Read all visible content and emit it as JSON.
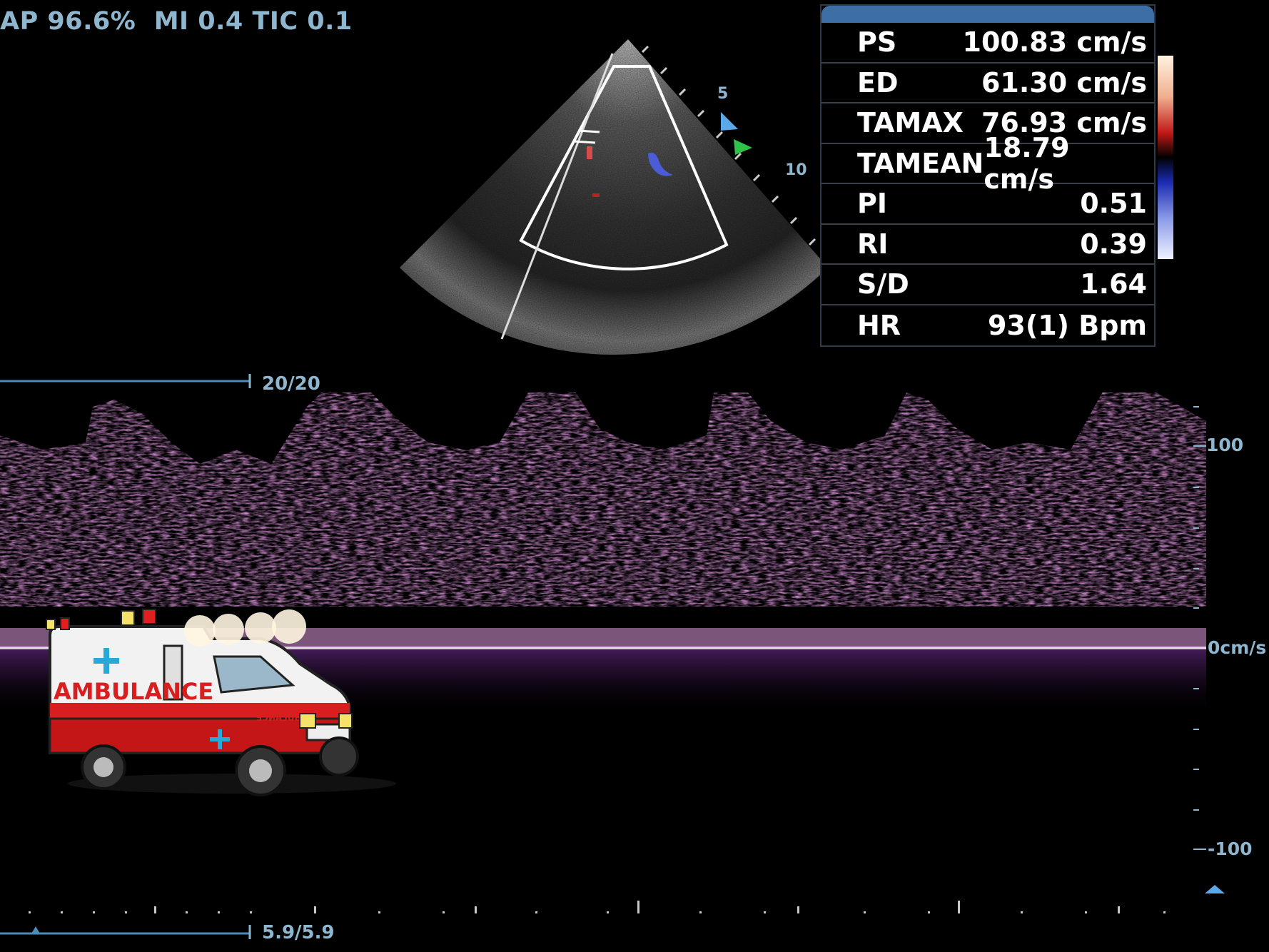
{
  "header": {
    "status_line": "AP 96.6%  MI 0.4 TIC 0.1"
  },
  "sector": {
    "depth_marks": [
      "5",
      "10"
    ]
  },
  "measurements": [
    {
      "label": "PS",
      "value": "100.83 cm/s"
    },
    {
      "label": "ED",
      "value": "61.30 cm/s"
    },
    {
      "label": "TAMAX",
      "value": "76.93 cm/s"
    },
    {
      "label": "TAMEAN",
      "value": "18.79 cm/s"
    },
    {
      "label": "PI",
      "value": "0.51"
    },
    {
      "label": "RI",
      "value": "0.39"
    },
    {
      "label": "S/D",
      "value": "1.64"
    },
    {
      "label": "HR",
      "value": "93(1) Bpm"
    }
  ],
  "sweep": {
    "top_label": "20/20",
    "bottom_label": "5.9/5.9"
  },
  "spectral_scale": {
    "top_label": "100",
    "baseline_label": "0cm/s",
    "bottom_label": "-100"
  },
  "colors": {
    "overlay_text": "#8fb6cf",
    "doppler_signal": "#c04bc0",
    "baseline": "#e0e0e0"
  },
  "overlay_image": {
    "side_text": "AMBULANCE",
    "hood_text": "AMBULANCE"
  }
}
